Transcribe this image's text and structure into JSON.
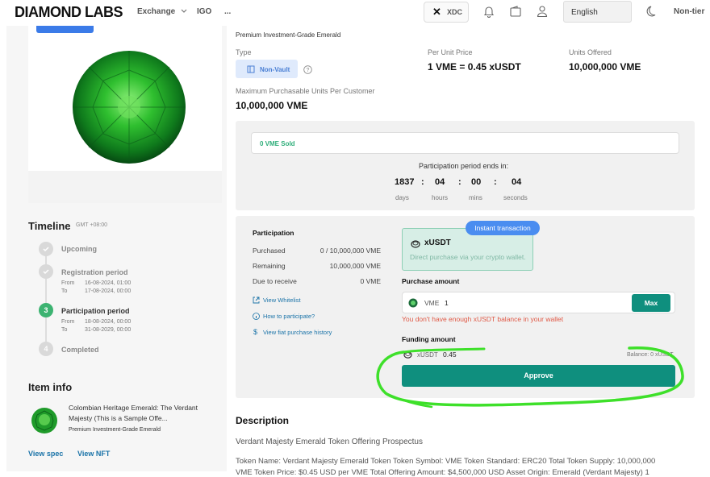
{
  "header": {
    "logo": "DIAMOND LABS",
    "nav": [
      {
        "label": "Exchange",
        "icon": "chevron-down-icon"
      },
      {
        "label": "IGO"
      },
      {
        "label": "..."
      }
    ],
    "network_button": "XDC",
    "language": "English",
    "tier": "Non-tier"
  },
  "left": {
    "timeline_title": "Timeline",
    "timezone": "GMT +08:00",
    "timeline": [
      {
        "step": "",
        "label": "Upcoming",
        "status": "done"
      },
      {
        "step": "",
        "label": "Registration period",
        "status": "done",
        "from_label": "From",
        "from": "16-08-2024, 01:00",
        "to_label": "To",
        "to": "17-08-2024, 00:00"
      },
      {
        "step": "3",
        "label": "Participation period",
        "status": "active",
        "from_label": "From",
        "from": "18-08-2024, 00:00",
        "to_label": "To",
        "to": "31-08-2029, 00:00"
      },
      {
        "step": "4",
        "label": "Completed",
        "status": "pending"
      }
    ],
    "item_info_title": "Item info",
    "item_name": "Colombian Heritage Emerald: The Verdant Majesty (This is a Sample Offe...",
    "item_sub": "Premium Investment-Grade Emerald",
    "view_spec": "View spec",
    "view_nft": "View NFT"
  },
  "main": {
    "subtitle": "Premium Investment-Grade Emerald",
    "type_label": "Type",
    "type_value": "Non-Vault",
    "per_unit_label": "Per Unit Price",
    "per_unit_value": "1 VME = 0.45 xUSDT",
    "units_offered_label": "Units Offered",
    "units_offered_value": "10,000,000 VME",
    "max_purchase_label": "Maximum Purchasable Units Per Customer",
    "max_purchase_value": "10,000,000 VME",
    "sold": "0 VME Sold",
    "period_ends": "Participation period ends in:",
    "countdown": {
      "days": "1837",
      "hours": "04",
      "mins": "00",
      "seconds": "04",
      "days_label": "days",
      "hours_label": "hours",
      "mins_label": "mins",
      "seconds_label": "seconds",
      "sep": ":"
    }
  },
  "participation": {
    "title": "Participation",
    "rows": [
      {
        "label": "Purchased",
        "value": "0 / 10,000,000 VME"
      },
      {
        "label": "Remaining",
        "value": "10,000,000 VME"
      },
      {
        "label": "Due to receive",
        "value": "0 VME"
      }
    ],
    "links": [
      "View Whitelist",
      "How to participate?",
      "View fiat purchase history"
    ]
  },
  "purchase": {
    "instant_badge": "Instant transaction",
    "card_title": "xUSDT",
    "card_desc": "Direct purchase via your crypto wallet.",
    "amount_label": "Purchase amount",
    "amount_token": "VME",
    "amount_value": "1",
    "max_label": "Max",
    "error": "You don't have enough xUSDT balance in your wallet",
    "funding_label": "Funding amount",
    "funding_token": "xUSDT",
    "funding_value": "0.45",
    "balance": "Balance: 0 xUSDT",
    "approve_label": "Approve"
  },
  "description": {
    "title": "Description",
    "line1": "Verdant Majesty Emerald Token Offering Prospectus",
    "line2": "Token Name: Verdant Majesty Emerald Token Token Symbol: VME Token Standard: ERC20 Total Token Supply: 10,000,000",
    "line3": "VME Token Price: $0.45 USD per VME Total Offering Amount: $4,500,000 USD Asset Origin: Emerald (Verdant Majesty) 1"
  },
  "colors": {
    "accent": "#0f8f7e",
    "blue": "#4a8df0",
    "annotation": "#3ee02a",
    "error": "#e05a47"
  }
}
